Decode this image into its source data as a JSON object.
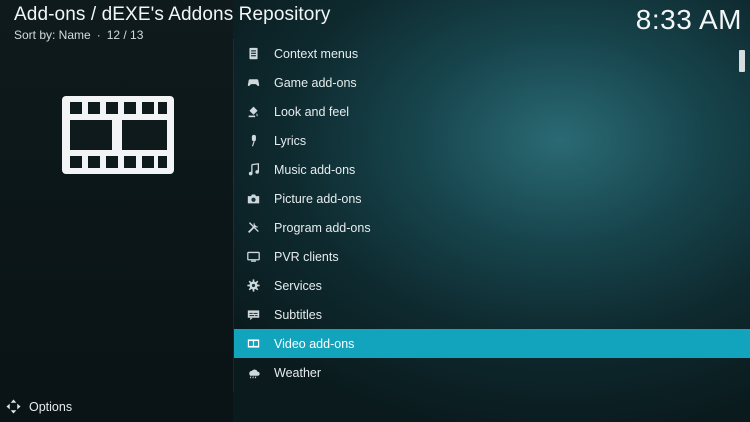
{
  "header": {
    "title": "Add-ons /  dEXE's Addons Repository",
    "sort_label": "Sort by: Name",
    "position": "12 / 13"
  },
  "clock": "8:33 AM",
  "preview": {
    "icon": "film-strip-icon"
  },
  "list": {
    "items": [
      {
        "label": "Context menus",
        "icon": "context-menu-icon"
      },
      {
        "label": "Game add-ons",
        "icon": "gamepad-icon"
      },
      {
        "label": "Look and feel",
        "icon": "paint-bucket-icon"
      },
      {
        "label": "Lyrics",
        "icon": "microphone-icon"
      },
      {
        "label": "Music add-ons",
        "icon": "music-note-icon"
      },
      {
        "label": "Picture add-ons",
        "icon": "camera-icon"
      },
      {
        "label": "Program add-ons",
        "icon": "tools-icon"
      },
      {
        "label": "PVR clients",
        "icon": "tv-icon"
      },
      {
        "label": "Services",
        "icon": "gear-icon"
      },
      {
        "label": "Subtitles",
        "icon": "subtitles-icon"
      },
      {
        "label": "Video add-ons",
        "icon": "film-icon",
        "selected": true
      },
      {
        "label": "Weather",
        "icon": "weather-icon"
      }
    ]
  },
  "footer": {
    "options_label": "Options",
    "icon": "options-arrows-icon"
  },
  "colors": {
    "accent": "#12a4bc",
    "background": "#0b1416"
  }
}
